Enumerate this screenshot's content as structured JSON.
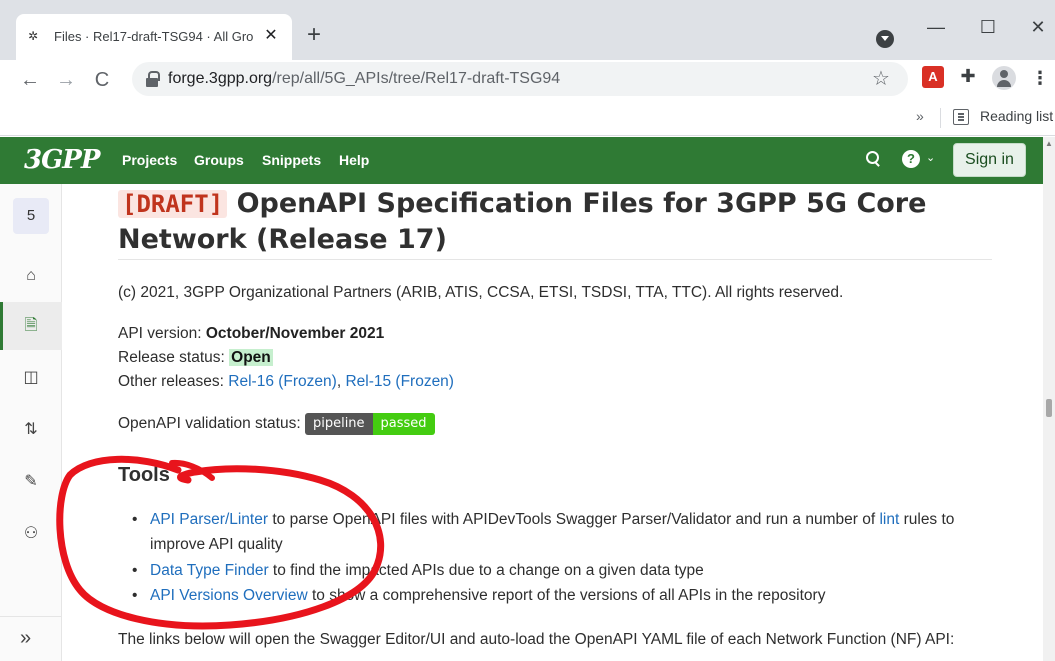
{
  "browser": {
    "tab_title": "Files · Rel17-draft-TSG94 · All Gro",
    "tab_favicon": "3GPP",
    "new_tab": "+",
    "url_host": "forge.3gpp.org",
    "url_path": "/rep/all/5G_APIs/tree/Rel17-draft-TSG94",
    "bookmarks_more": "»",
    "reading_list": "Reading list",
    "ext_pdf": "A"
  },
  "gitlab": {
    "logo": "3GPP",
    "nav": {
      "projects": "Projects",
      "groups": "Groups",
      "snippets": "Snippets",
      "help": "Help"
    },
    "help_icon": "?",
    "sign_in": "Sign in"
  },
  "sidebar": {
    "project_avatar": "5",
    "items": [
      {
        "icon": "home-icon",
        "glyph": "⌂"
      },
      {
        "icon": "repository-icon",
        "glyph": "🗎"
      },
      {
        "icon": "issues-icon",
        "glyph": "◫"
      },
      {
        "icon": "merge-requests-icon",
        "glyph": "⇅"
      },
      {
        "icon": "rocket-icon",
        "glyph": "✎"
      },
      {
        "icon": "members-icon",
        "glyph": "⚇"
      }
    ],
    "collapse": "»"
  },
  "content": {
    "draft_tag": "[DRAFT]",
    "title_rest": "OpenAPI Specification Files for 3GPP 5G Core Network (Release 17)",
    "copyright": "(c) 2021, 3GPP Organizational Partners (ARIB, ATIS, CCSA, ETSI, TSDSI, TTA, TTC). All rights reserved.",
    "api_version_label": "API version: ",
    "api_version_value": "October/November 2021",
    "release_status_label": "Release status: ",
    "release_status_value": "Open",
    "other_releases_label": "Other releases: ",
    "rel16": "Rel-16 (Frozen)",
    "separator": ", ",
    "rel15": "Rel-15 (Frozen)",
    "validation_label": "OpenAPI validation status: ",
    "badge_left": "pipeline",
    "badge_right": "passed",
    "tools_heading": "Tools",
    "tool1_link": "API Parser/Linter",
    "tool1_text": " to parse OpenAPI files with APIDevTools Swagger Parser/Validator and run a number of ",
    "tool1_link2": "lint",
    "tool1_text2": " rules to",
    "tool1_cont": "improve API quality",
    "tool2_link": "Data Type Finder",
    "tool2_text": " to find the impacted APIs due to a change on a given data type",
    "tool3_link": "API Versions Overview",
    "tool3_text": " to show a comprehensive report of the versions of all APIs in the repository",
    "links_intro": "The links below will open the Swagger Editor/UI and auto-load the OpenAPI YAML file of each Network Function (NF) API:"
  },
  "colors": {
    "header_green": "#2f7a34",
    "link_blue": "#1f6ebd",
    "draft_red": "#c0341d",
    "annotation_red": "#e8141c",
    "badge_grey": "#555555",
    "badge_green": "#44cc11"
  }
}
